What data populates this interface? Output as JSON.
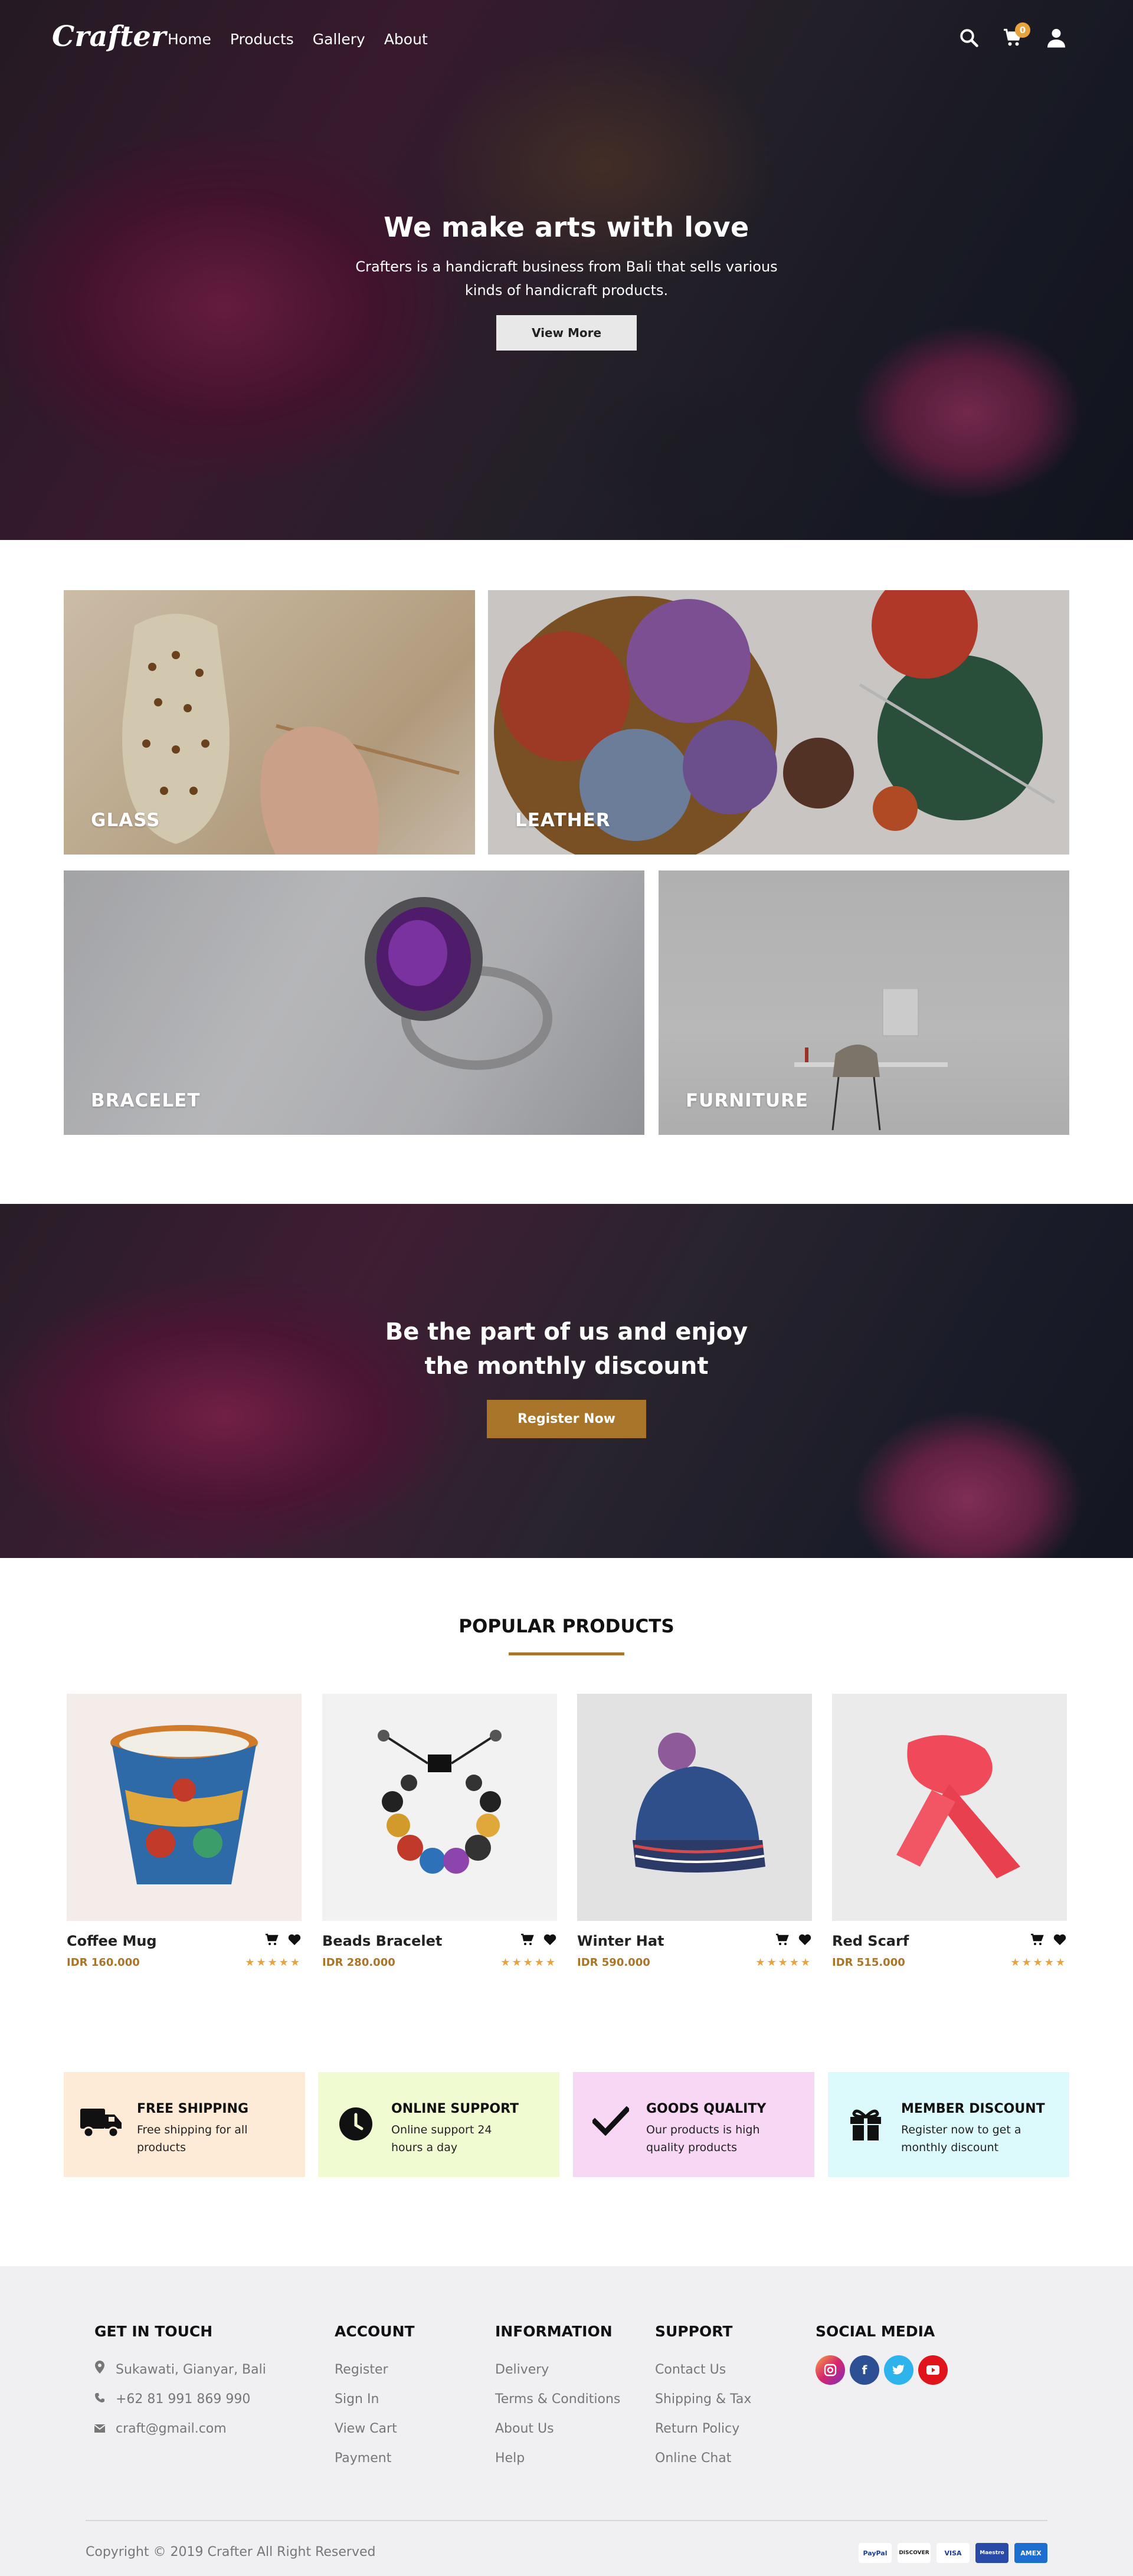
{
  "nav": {
    "logo": "Crafter",
    "links": [
      "Home",
      "Products",
      "Gallery",
      "About"
    ],
    "cart_count": "0",
    "icons": [
      "search-icon",
      "cart-icon",
      "user-icon"
    ]
  },
  "hero": {
    "title": "We make arts with love",
    "subtitle": "Crafters is a handicraft business from Bali that sells various kinds of handicraft products.",
    "button": "View More"
  },
  "categories": [
    "GLASS",
    "LEATHER",
    "BRACELET",
    "FURNITURE"
  ],
  "cta": {
    "title_line1": "Be the part of us and enjoy",
    "title_line2": "the monthly discount",
    "button": "Register Now"
  },
  "popular": {
    "title": "POPULAR PRODUCTS",
    "products": [
      {
        "name": "Coffee Mug",
        "price": "IDR 160.000",
        "rating": 5,
        "bg": "#f4ece9"
      },
      {
        "name": "Beads Bracelet",
        "price": "IDR 280.000",
        "rating": 5,
        "bg": "#f2f2f2"
      },
      {
        "name": "Winter Hat",
        "price": "IDR 590.000",
        "rating": 5,
        "bg": "#e2e2e2"
      },
      {
        "name": "Red Scarf",
        "price": "IDR 515.000",
        "rating": 5,
        "bg": "#ebebeb"
      }
    ]
  },
  "features": [
    {
      "title": "FREE SHIPPING",
      "desc": "Free shipping for all products",
      "bg": "#fdebd7",
      "icon": "truck-icon"
    },
    {
      "title": "ONLINE SUPPORT",
      "desc": "Online support 24 hours a day",
      "bg": "#f1fbd2",
      "icon": "clock-icon"
    },
    {
      "title": "GOODS QUALITY",
      "desc": "Our products is high quality products",
      "bg": "#f7d7f4",
      "icon": "checkmark-icon"
    },
    {
      "title": "MEMBER DISCOUNT",
      "desc": "Register now to get a monthly discount",
      "bg": "#dcf9fb",
      "icon": "gift-icon"
    }
  ],
  "footer": {
    "get_in_touch": {
      "title": "GET IN TOUCH",
      "address": "Sukawati, Gianyar, Bali",
      "phone": "+62 81 991 869 990",
      "email": "craft@gmail.com"
    },
    "account": {
      "title": "ACCOUNT",
      "links": [
        "Register",
        "Sign In",
        "View Cart",
        "Payment"
      ]
    },
    "information": {
      "title": "INFORMATION",
      "links": [
        "Delivery",
        "Terms & Conditions",
        "About Us",
        "Help"
      ]
    },
    "support": {
      "title": "SUPPORT",
      "links": [
        "Contact Us",
        "Shipping & Tax",
        "Return Policy",
        "Online Chat"
      ]
    },
    "social": {
      "title": "SOCIAL MEDIA",
      "icons": [
        "instagram-icon",
        "facebook-icon",
        "twitter-icon",
        "youtube-icon"
      ]
    },
    "copyright": "Copyright © 2019 Crafter All Right Reserved",
    "payments": [
      "PayPal",
      "DISCOVER",
      "VISA",
      "Maestro",
      "AMEX"
    ]
  }
}
